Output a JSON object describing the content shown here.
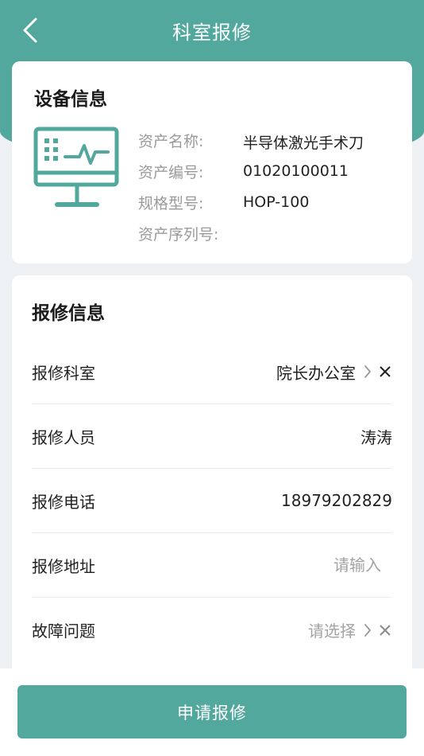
{
  "header": {
    "title": "科室报修"
  },
  "device_info": {
    "section_title": "设备信息",
    "rows": [
      {
        "label": "资产名称:",
        "value": "半导体激光手术刀"
      },
      {
        "label": "资产编号:",
        "value": "01020100011"
      },
      {
        "label": "规格型号:",
        "value": "HOP-100"
      },
      {
        "label": "资产序列号:",
        "value": ""
      }
    ]
  },
  "repair_info": {
    "section_title": "报修信息",
    "department": {
      "label": "报修科室",
      "value": "院长办公室"
    },
    "person": {
      "label": "报修人员",
      "value": "涛涛"
    },
    "phone": {
      "label": "报修电话",
      "value": "18979202829"
    },
    "address": {
      "label": "报修地址",
      "placeholder": "请输入"
    },
    "fault": {
      "label": "故障问题",
      "placeholder": "请选择"
    }
  },
  "footer": {
    "submit_label": "申请报修"
  },
  "colors": {
    "accent": "#52a89d",
    "background": "#eef1f4"
  }
}
